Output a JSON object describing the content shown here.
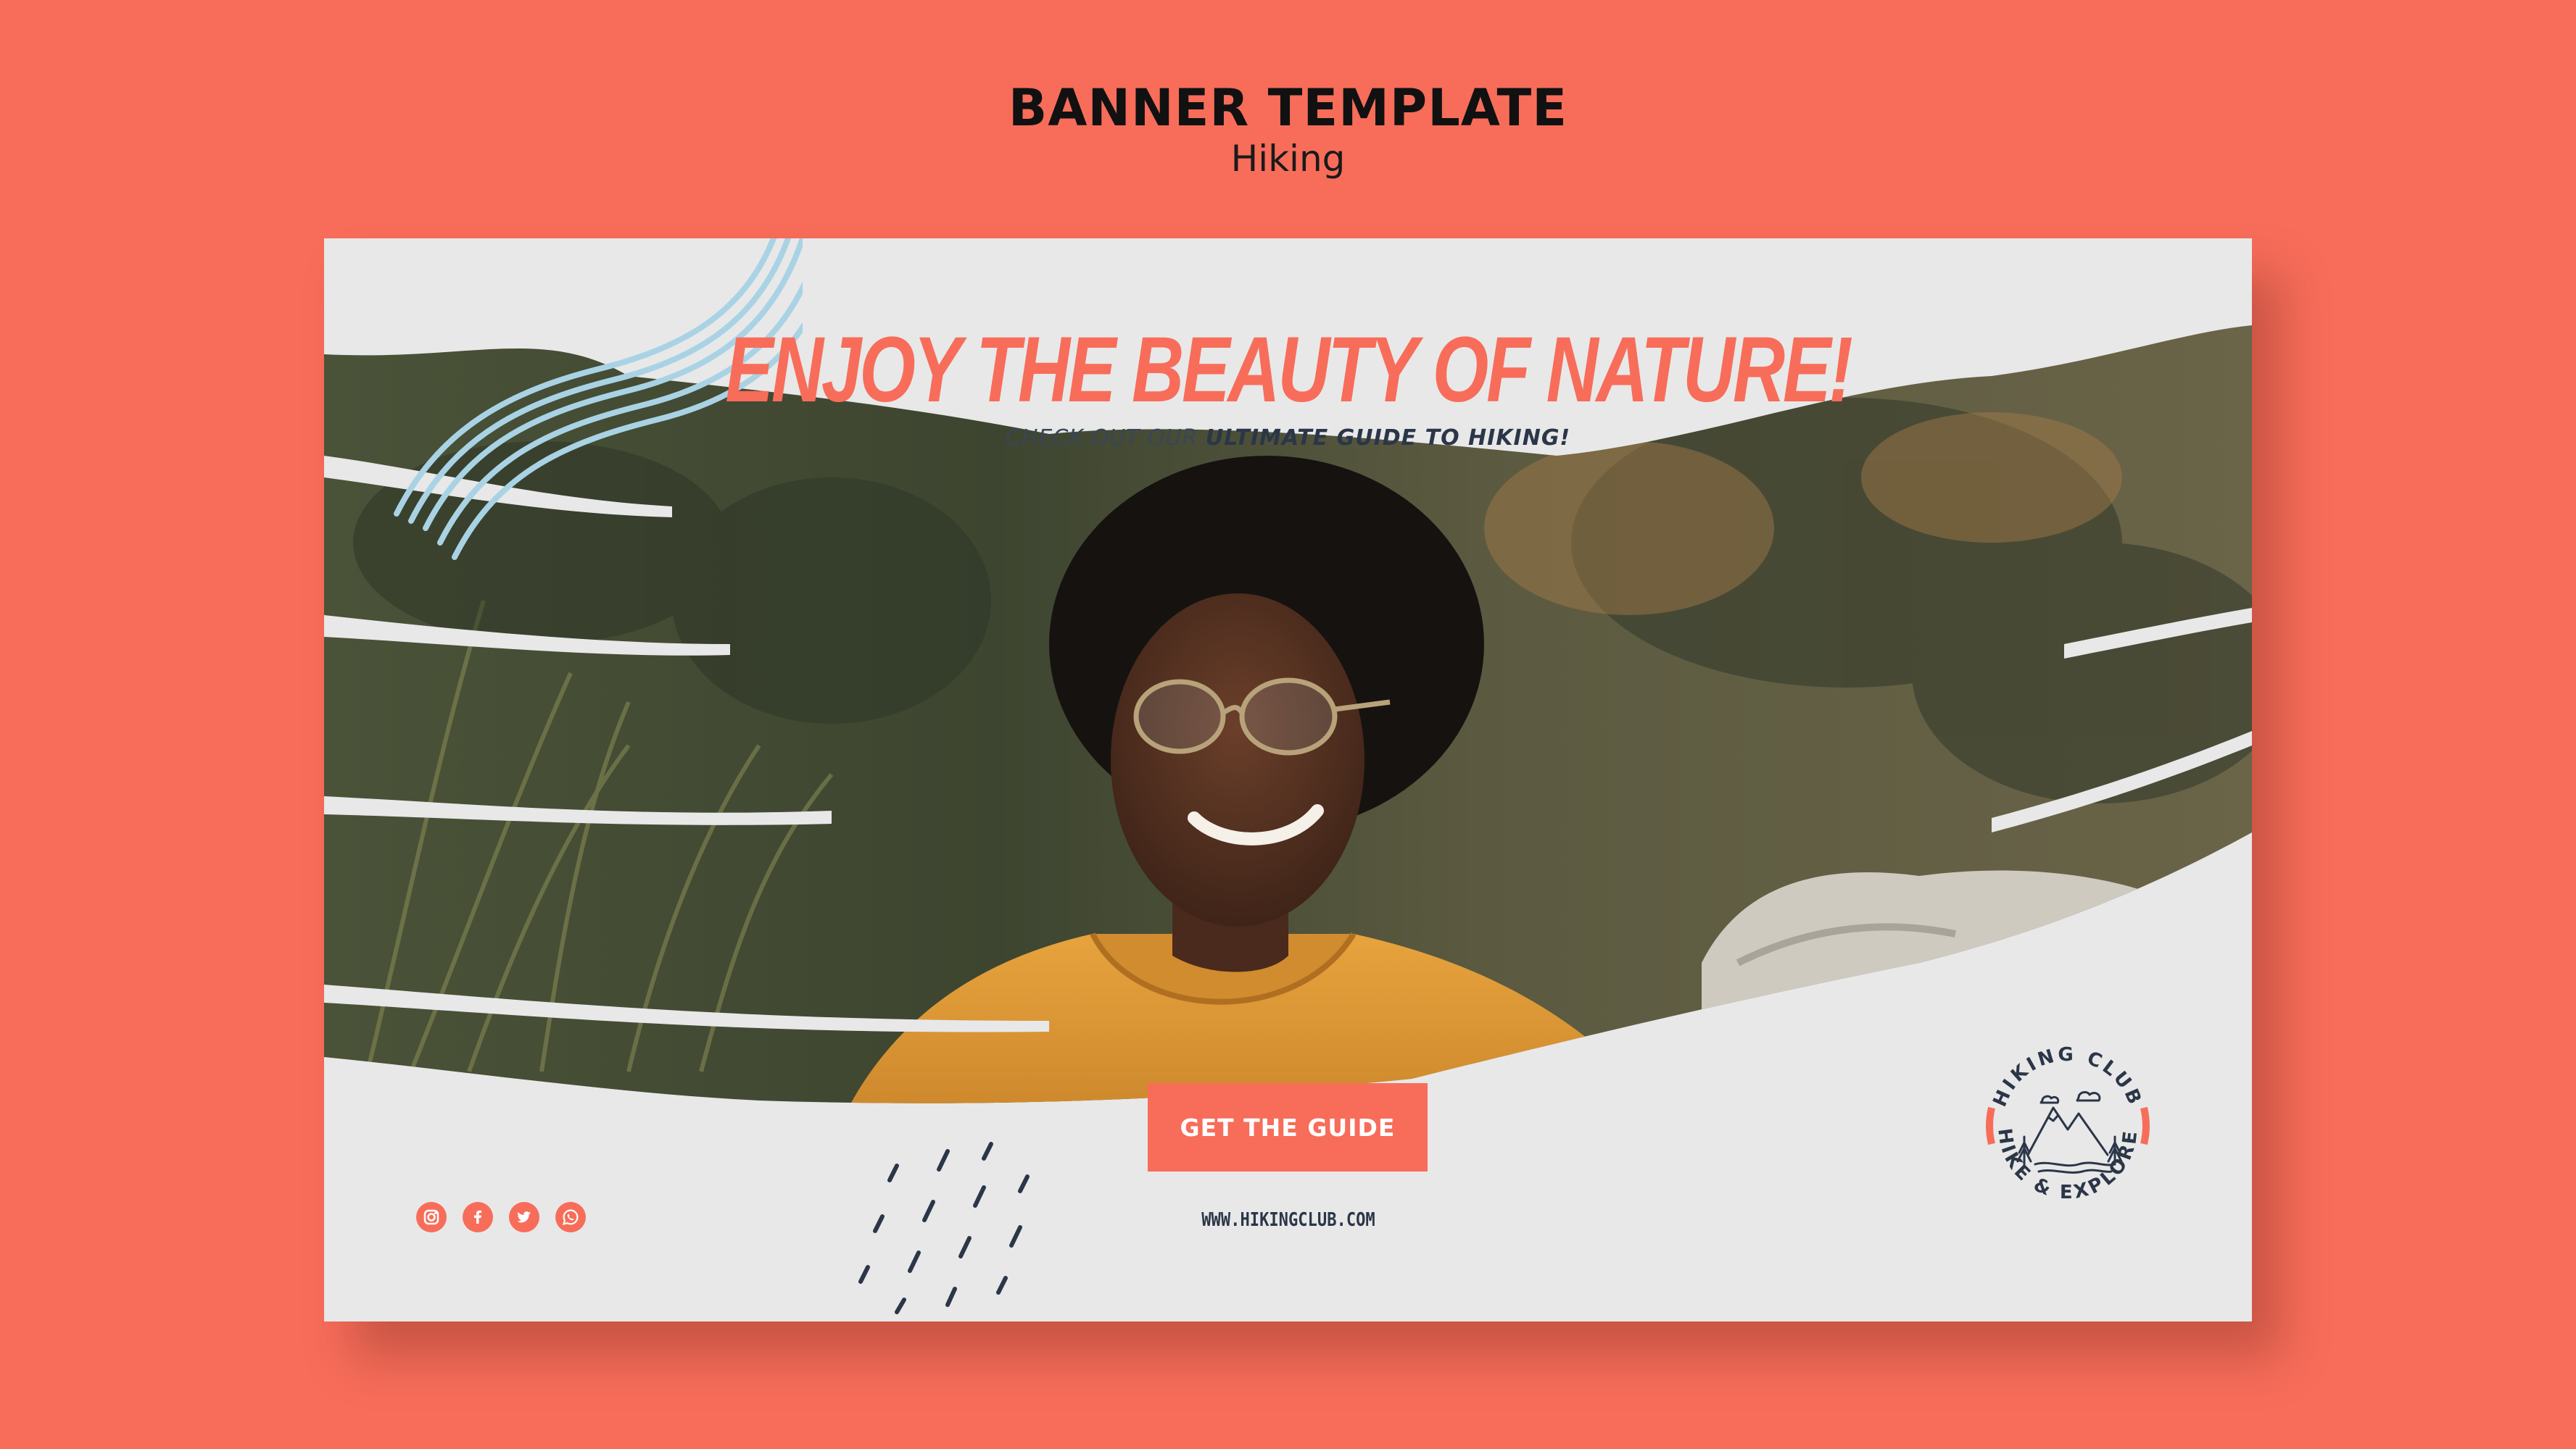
{
  "page": {
    "title": "BANNER TEMPLATE",
    "subtitle": "Hiking"
  },
  "banner": {
    "headline": "ENJOY THE BEAUTY OF NATURE!",
    "subline_prefix": "CHECK OUT OUR ",
    "subline_bold": "ULTIMATE GUIDE TO HIKING!",
    "cta_label": "GET THE GUIDE",
    "url": "WWW.HIKINGCLUB.COM",
    "badge": {
      "top_text": "HIKING CLUB",
      "bottom_text": "HIKE & EXPLORE"
    },
    "social_icons": [
      "instagram-icon",
      "facebook-icon",
      "twitter-icon",
      "whatsapp-icon"
    ]
  },
  "colors": {
    "background": "#f76d5a",
    "accent": "#f76d5a",
    "card": "#e8e8e8",
    "text_dark": "#2b3648",
    "swirl": "#a9d3e4"
  }
}
